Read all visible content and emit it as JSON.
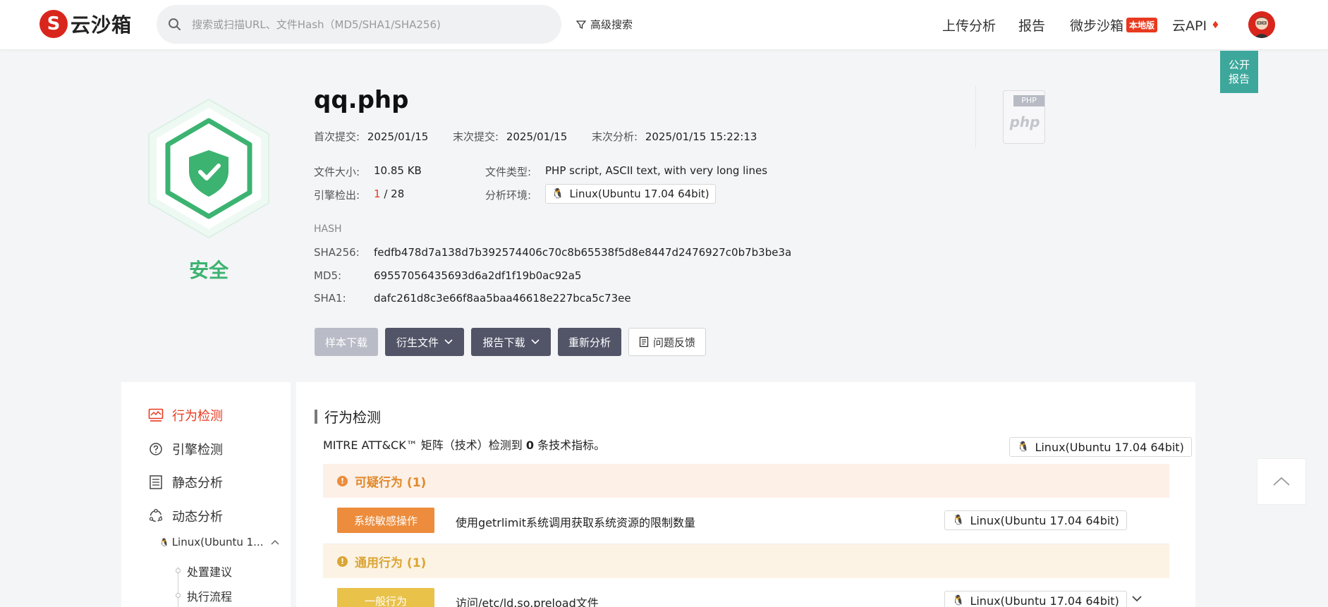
{
  "header": {
    "logo_mark": "S",
    "logo_text": "云沙箱",
    "search_placeholder": "搜索或扫描URL、文件Hash（MD5/SHA1/SHA256)",
    "advanced_search": "高级搜索",
    "nav": {
      "upload": "上传分析",
      "report": "报告",
      "micro_sandbox": "微步沙箱",
      "local_badge": "本地版",
      "api": "云API"
    }
  },
  "public_report": [
    "公开",
    "报告"
  ],
  "verdict": "安全",
  "file": {
    "name": "qq.php",
    "first_submit_label": "首次提交:",
    "first_submit": "2025/01/15",
    "last_submit_label": "末次提交:",
    "last_submit": "2025/01/15",
    "last_analysis_label": "末次分析:",
    "last_analysis": "2025/01/15 15:22:13",
    "size_label": "文件大小:",
    "size": "10.85 KB",
    "type_label": "文件类型:",
    "type": "PHP script, ASCII text, with very long lines",
    "engine_label": "引擎检出:",
    "engine_detected": "1",
    "engine_total": "/ 28",
    "env_label": "分析环境:",
    "env": "Linux(Ubuntu 17.04 64bit)",
    "icon_tag": "PHP",
    "icon_word": "php"
  },
  "hash": {
    "title": "HASH",
    "sha256_label": "SHA256:",
    "sha256": "fedfb478d7a138d7b392574406c70c8b65538f5d8e8447d2476927c0b7b3be3a",
    "md5_label": "MD5:",
    "md5": "69557056435693d6a2df1f19b0ac92a5",
    "sha1_label": "SHA1:",
    "sha1": "dafc261d8c3e66f8aa5baa46618e227bca5c73ee"
  },
  "actions": {
    "sample_download": "样本下载",
    "derived_files": "衍生文件",
    "report_download": "报告下载",
    "reanalyze": "重新分析",
    "feedback": "问题反馈"
  },
  "sidebar": {
    "behavior": "行为检测",
    "engine": "引擎检测",
    "static": "静态分析",
    "dynamic": "动态分析",
    "env": "Linux(Ubuntu 1...",
    "leaf_advice": "处置建议",
    "leaf_flow": "执行流程"
  },
  "content": {
    "section_title": "行为检测",
    "mitre_prefix": "MITRE ATT&CK™ 矩阵（技术）检测到",
    "mitre_count": "0",
    "mitre_suffix": "条技术指标。",
    "env": "Linux(Ubuntu 17.04 64bit)",
    "suspicious_title": "可疑行为 (1)",
    "suspicious_tag": "系统敏感操作",
    "suspicious_text": "使用getrlimit系统调用获取系统资源的限制数量",
    "general_title": "通用行为 (1)",
    "general_tag": "一般行为",
    "general_text": "访问/etc/ld.so.preload文件"
  },
  "colors": {
    "brand_red": "#d9261c",
    "safe_green": "#3cb371",
    "suspicious_orange": "#ec8c3c",
    "general_yellow": "#e9c24a",
    "teal": "#3ea79b"
  }
}
